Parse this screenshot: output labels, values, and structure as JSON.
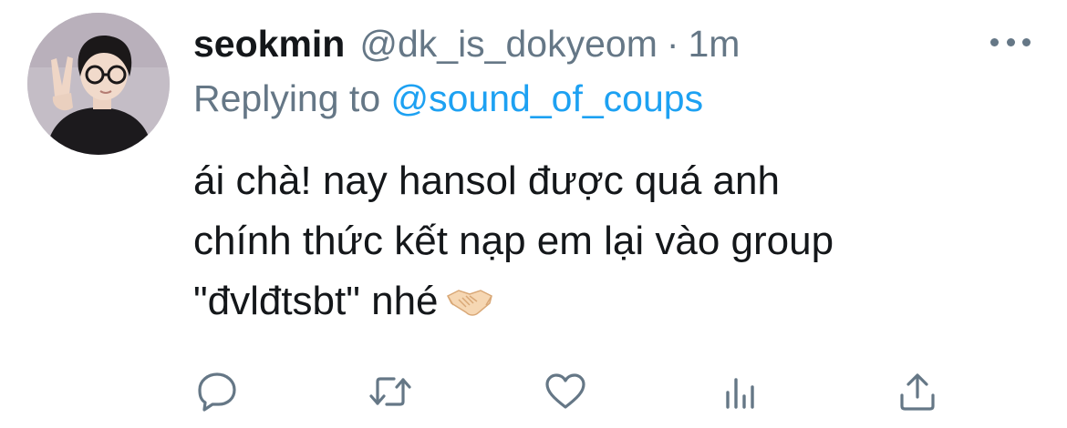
{
  "tweet": {
    "display_name": "seokmin",
    "handle": "@dk_is_dokyeom",
    "separator": "·",
    "time": "1m",
    "replying_prefix": "Replying to",
    "replying_to": "@sound_of_coups",
    "body_lines": [
      "ái chà! nay hansol được quá anh",
      "chính thức kết nạp em lại vào group",
      "\"đvlđtsbt\" nhé"
    ],
    "emoji": "handshake-icon"
  },
  "colors": {
    "text": "#14171a",
    "secondary": "#657786",
    "link": "#1da1f2"
  },
  "actions": [
    {
      "name": "reply",
      "icon": "reply-icon"
    },
    {
      "name": "retweet",
      "icon": "retweet-icon"
    },
    {
      "name": "like",
      "icon": "heart-icon"
    },
    {
      "name": "analytics",
      "icon": "analytics-icon"
    },
    {
      "name": "share",
      "icon": "share-icon"
    }
  ]
}
